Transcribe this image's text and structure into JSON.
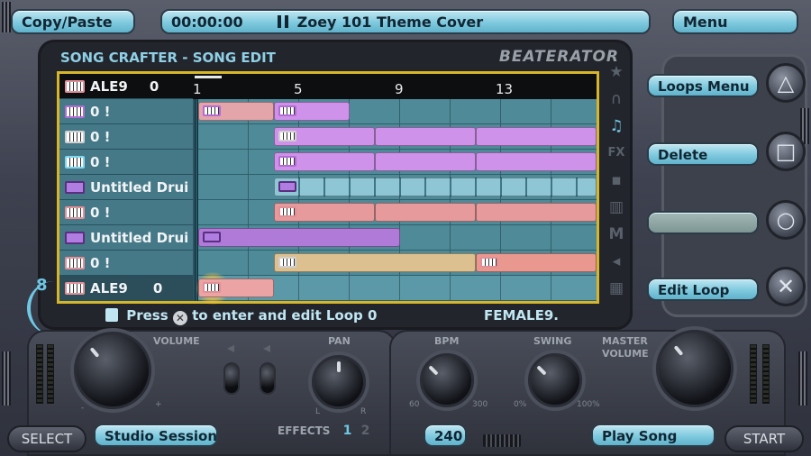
{
  "top_bar": {
    "copy_paste_label": "Copy/Paste",
    "time": "00:00:00",
    "song_title": "Zoey 101 Theme Cover",
    "menu_label": "Menu"
  },
  "panel": {
    "title": "SONG CRAFTER - SONG EDIT",
    "brand": "BEATERATOR"
  },
  "ruler": {
    "ticks": [
      "1",
      "5",
      "9",
      "13"
    ]
  },
  "header_row": {
    "name": "ALE9",
    "value": "0"
  },
  "tracks": [
    {
      "label": "0 !",
      "icon": "keyboard-icon"
    },
    {
      "label": "0 !",
      "icon": "keyboard-icon"
    },
    {
      "label": "0 !",
      "icon": "keyboard-icon"
    },
    {
      "label": "Untitled Drui",
      "icon": "drum-icon"
    },
    {
      "label": "0 !",
      "icon": "keyboard-icon"
    },
    {
      "label": "Untitled Drui",
      "icon": "drum-icon"
    },
    {
      "label": "0 !",
      "icon": "keyboard-icon"
    },
    {
      "label": "ALE9",
      "value": "0",
      "icon": "keyboard-icon",
      "selected": true
    }
  ],
  "status": {
    "press": "Press",
    "hint_rest": "to enter and edit Loop 0",
    "button_glyph": "✕",
    "sample": "FEMALE9."
  },
  "side_icons": [
    "star-icon",
    "headphones-icon",
    "notes-icon",
    "fx-icon",
    "drum-pads-icon",
    "keyboard-icon",
    "m-icon",
    "speaker-icon",
    "grid-icon"
  ],
  "right_menu": {
    "loops_menu": "Loops Menu",
    "delete": "Delete",
    "edit_loop": "Edit Loop",
    "triangle": "△",
    "square": "□",
    "circle": "○",
    "cross": "✕"
  },
  "controls": {
    "volume_label": "VOLUME",
    "pan_label": "PAN",
    "pan_l": "L",
    "pan_r": "R",
    "bpm_label": "BPM",
    "bpm_min": "60",
    "bpm_max": "300",
    "swing_label": "SWING",
    "swing_min": "0%",
    "swing_max": "100%",
    "master_label_1": "MASTER",
    "master_label_2": "VOLUME",
    "effects_label": "EFFECTS",
    "effects_1": "1",
    "effects_2": "2",
    "channel_number": "8",
    "volume_minus": "-",
    "volume_plus": "+"
  },
  "bottom": {
    "select": "SELECT",
    "studio_session": "Studio Session",
    "bpm_value": "240",
    "play_song": "Play Song",
    "start": "START"
  },
  "colors": {
    "accent_cyan": "#7fc9de",
    "grid_border": "#d6b52a",
    "clip_pink": "#e6a0a4",
    "clip_purple": "#c88fe6",
    "clip_tan": "#dcc08f",
    "clip_salmon": "#e99890",
    "clip_drum_cells": "#86bfd0"
  }
}
